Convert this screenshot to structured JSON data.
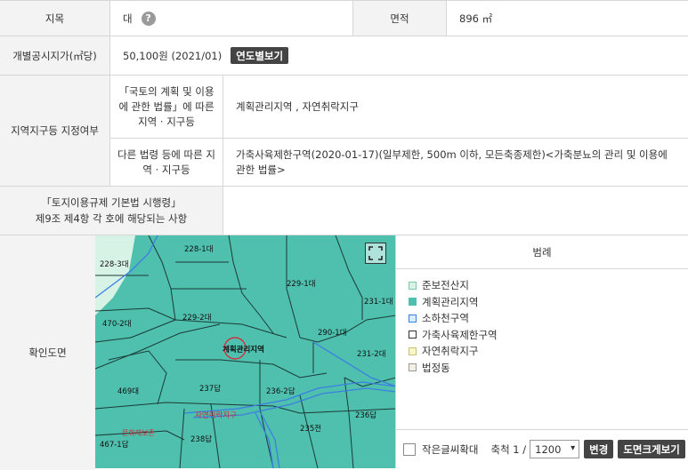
{
  "rows": {
    "jimok": {
      "label": "지목",
      "value": "대",
      "help": "?",
      "area_label": "면적",
      "area_value": "896 ㎡"
    },
    "price": {
      "label": "개별공시지가(㎡당)",
      "value": "50,100원 (2021/01)",
      "button": "연도별보기"
    },
    "zone": {
      "label": "지역지구등 지정여부",
      "sub1_label": "「국토의 계획 및 이용에 관한 법률」에 따른 지역 · 지구등",
      "sub1_value": "계획관리지역 , 자연취락지구",
      "sub2_label": "다른 법령 등에 따른 지역 · 지구등",
      "sub2_value": "가축사육제한구역(2020-01-17)(일부제한, 500m 이하, 모든축종제한)<가축분뇨의 관리 및 이용에 관한 법률>"
    },
    "law": {
      "label_line1": "「토지이용규제 기본법 시행령」",
      "label_line2": "제9조 제4항 각 호에 해당되는 사항",
      "value": ""
    },
    "map": {
      "label": "확인도면"
    }
  },
  "map_labels": [
    "228-1대",
    "228-3대",
    "229-1대",
    "231-1대",
    "470-2대",
    "229-2대",
    "290-1대",
    "231-2대",
    "469대",
    "계획관리지역",
    "237답",
    "236-2답",
    "236답",
    "자연취락지구",
    "235전",
    "467-1답",
    "238답",
    "문화재보존"
  ],
  "legend": {
    "title": "범례",
    "items": [
      {
        "label": "준보전산지",
        "color": "#d7f3e6"
      },
      {
        "label": "계획관리지역",
        "color": "#4fbfae"
      },
      {
        "label": "소하천구역",
        "color": "#d6ecff"
      },
      {
        "label": "가축사육제한구역",
        "color": "#ffffff"
      },
      {
        "label": "자연취락지구",
        "color": "#fbf7c4"
      },
      {
        "label": "법정동",
        "color": "#f4f0e6"
      }
    ],
    "small_text": "작은글씨확대",
    "scale_label": "축척 1 /",
    "scale_value": "1200",
    "change_button": "변경",
    "view_button": "도면크게보기"
  }
}
